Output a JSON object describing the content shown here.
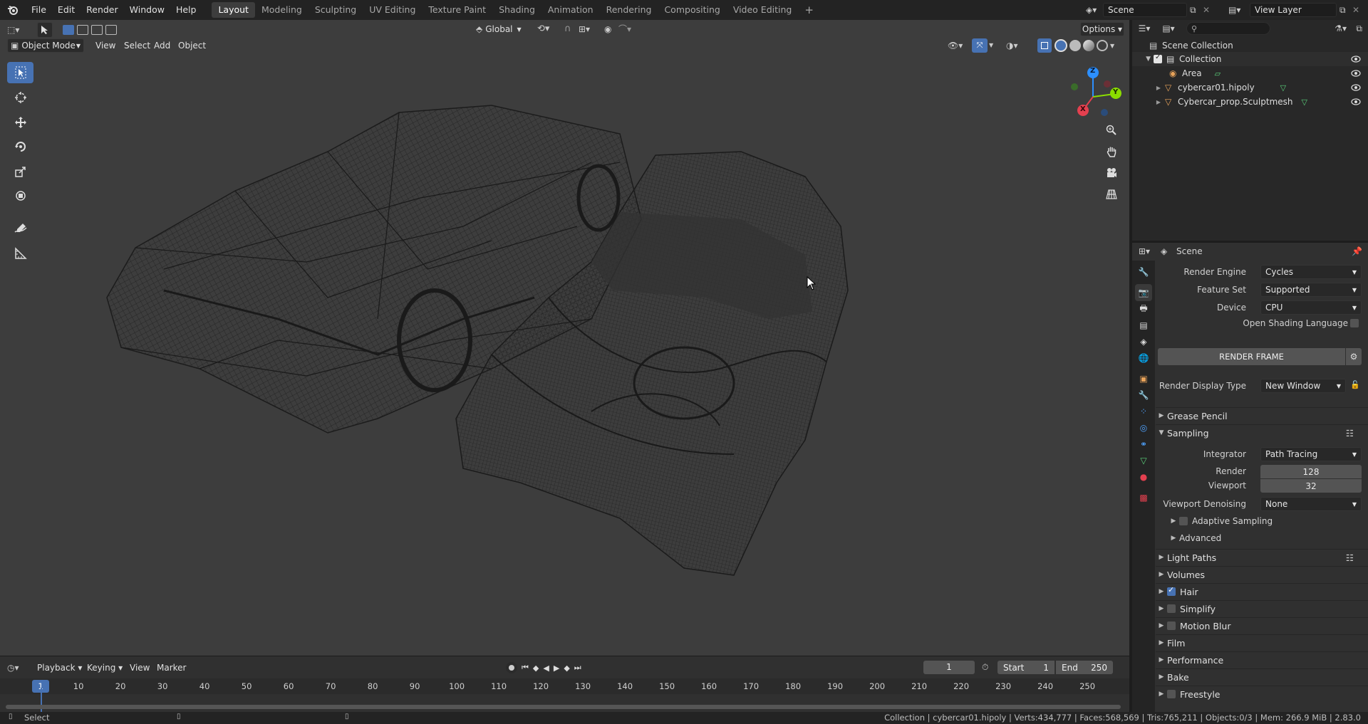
{
  "topbar": {
    "menus": [
      "File",
      "Edit",
      "Render",
      "Window",
      "Help"
    ],
    "workspaces": [
      "Layout",
      "Modeling",
      "Sculpting",
      "UV Editing",
      "Texture Paint",
      "Shading",
      "Animation",
      "Rendering",
      "Compositing",
      "Video Editing"
    ],
    "active_workspace": "Layout",
    "add_tab": "+",
    "scene_name": "Scene",
    "view_layer": "View Layer"
  },
  "viewport": {
    "mode": "Object Mode",
    "menus": [
      "View",
      "Select",
      "Add",
      "Object"
    ],
    "transform_orientation": "Global",
    "options": "Options",
    "gizmo": {
      "x": "X",
      "y": "Y",
      "z": "Z"
    }
  },
  "outliner": {
    "root": "Scene Collection",
    "collection": "Collection",
    "items": [
      "Area",
      "cybercar01.hipoly",
      "Cybercar_prop.Sculptmesh"
    ]
  },
  "properties": {
    "context": "Scene",
    "render_engine_label": "Render Engine",
    "render_engine": "Cycles",
    "feature_set_label": "Feature Set",
    "feature_set": "Supported",
    "device_label": "Device",
    "device": "CPU",
    "osl_label": "Open Shading Language",
    "render_frame": "RENDER FRAME",
    "display_type_label": "Render Display Type",
    "display_type": "New Window",
    "panels": {
      "grease_pencil": "Grease Pencil",
      "sampling": "Sampling",
      "integrator_label": "Integrator",
      "integrator": "Path Tracing",
      "render_label": "Render",
      "render_samples": "128",
      "viewport_label": "Viewport",
      "viewport_samples": "32",
      "denoise_label": "Viewport Denoising",
      "denoise": "None",
      "adaptive": "Adaptive Sampling",
      "advanced": "Advanced",
      "light_paths": "Light Paths",
      "volumes": "Volumes",
      "hair": "Hair",
      "simplify": "Simplify",
      "motion_blur": "Motion Blur",
      "film": "Film",
      "performance": "Performance",
      "bake": "Bake",
      "freestyle": "Freestyle"
    }
  },
  "timeline": {
    "menus": [
      "Playback",
      "Keying",
      "View",
      "Marker"
    ],
    "current_frame": "1",
    "start_label": "Start",
    "start": "1",
    "end_label": "End",
    "end": "250",
    "ticks": [
      "1",
      "10",
      "20",
      "30",
      "40",
      "50",
      "60",
      "70",
      "80",
      "90",
      "100",
      "110",
      "120",
      "130",
      "140",
      "150",
      "160",
      "170",
      "180",
      "190",
      "200",
      "210",
      "220",
      "230",
      "240",
      "250"
    ]
  },
  "statusbar": {
    "left": "Select",
    "right": "Collection | cybercar01.hipoly | Verts:434,777 | Faces:568,569 | Tris:765,211 | Objects:0/3 | Mem: 266.9 MiB | 2.83.0"
  },
  "colors": {
    "accent": "#4772b3",
    "viewport_bg": "#3d3d3d",
    "axis_x": "#e4404f",
    "axis_y": "#8bdc00",
    "axis_z": "#2c8fff"
  }
}
